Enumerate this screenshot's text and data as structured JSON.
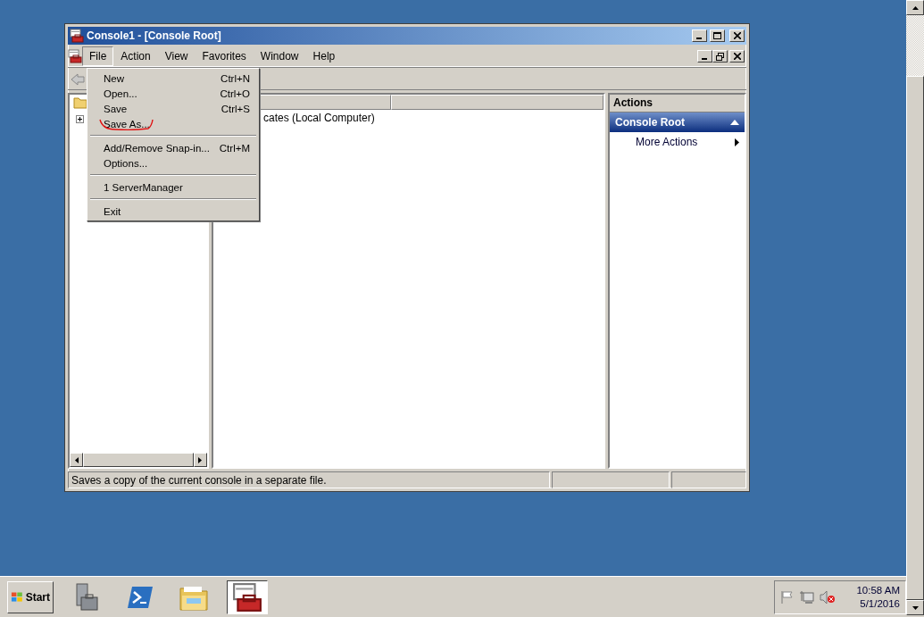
{
  "window": {
    "title": "Console1 - [Console Root]"
  },
  "menu_bar": [
    {
      "label": "File",
      "selected": true
    },
    {
      "label": "Action",
      "selected": false
    },
    {
      "label": "View",
      "selected": false
    },
    {
      "label": "Favorites",
      "selected": false
    },
    {
      "label": "Window",
      "selected": false
    },
    {
      "label": "Help",
      "selected": false
    }
  ],
  "file_menu": [
    {
      "kind": "item",
      "label": "New",
      "shortcut": "Ctrl+N",
      "annotated": false
    },
    {
      "kind": "item",
      "label": "Open...",
      "shortcut": "Ctrl+O",
      "annotated": false
    },
    {
      "kind": "item",
      "label": "Save",
      "shortcut": "Ctrl+S",
      "annotated": false
    },
    {
      "kind": "item",
      "label": "Save As...",
      "annotated": true
    },
    {
      "kind": "separator"
    },
    {
      "kind": "item",
      "label": "Add/Remove Snap-in...",
      "shortcut": "Ctrl+M",
      "annotated": false
    },
    {
      "kind": "item",
      "label": "Options...",
      "annotated": false
    },
    {
      "kind": "separator"
    },
    {
      "kind": "item",
      "label": "1 ServerManager",
      "annotated": false
    },
    {
      "kind": "separator"
    },
    {
      "kind": "item",
      "label": "Exit",
      "annotated": false
    }
  ],
  "list": {
    "items": [
      "cates (Local Computer)"
    ]
  },
  "actions": {
    "title": "Actions",
    "section": "Console Root",
    "items": [
      "More Actions"
    ]
  },
  "status_bar": {
    "text": "Saves a copy of the current console in a separate file."
  },
  "taskbar": {
    "start": "Start",
    "apps": [
      {
        "kind": "server",
        "selected": false
      },
      {
        "kind": "powershell",
        "selected": false
      },
      {
        "kind": "explorer",
        "selected": false
      },
      {
        "kind": "toolbox",
        "selected": true
      }
    ],
    "clock": {
      "time": "10:58 AM",
      "date": "5/1/2016"
    }
  }
}
